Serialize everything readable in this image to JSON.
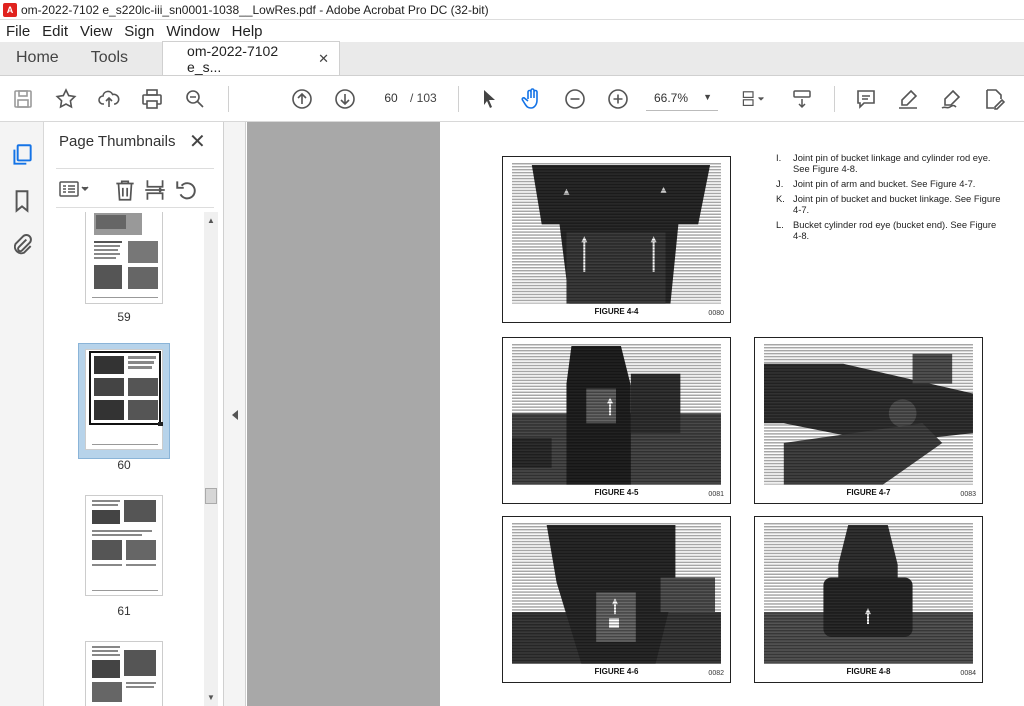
{
  "window": {
    "title": "om-2022-7102 e_s220lc-iii_sn0001-1038__LowRes.pdf - Adobe Acrobat Pro DC (32-bit)"
  },
  "menu": [
    "File",
    "Edit",
    "View",
    "Sign",
    "Window",
    "Help"
  ],
  "tabs": {
    "home": "Home",
    "tools": "Tools",
    "document": "om-2022-7102 e_s...",
    "close": "✕"
  },
  "toolbar": {
    "page_current": "60",
    "page_total": "/ 103",
    "zoom": "66.7%"
  },
  "panel": {
    "title": "Page Thumbnails",
    "close": "✕",
    "thumbnails": [
      {
        "label": "59",
        "selected": false
      },
      {
        "label": "60",
        "selected": true
      },
      {
        "label": "61",
        "selected": false
      },
      {
        "label": "",
        "selected": false
      }
    ]
  },
  "document": {
    "pin_list": [
      {
        "letter": "I.",
        "text": "Joint pin of bucket linkage and cylinder rod eye. See Figure 4-8."
      },
      {
        "letter": "J.",
        "text": "Joint pin of arm and bucket. See Figure 4-7."
      },
      {
        "letter": "K.",
        "text": "Joint pin of bucket and bucket linkage. See Figure 4-7."
      },
      {
        "letter": "L.",
        "text": "Bucket cylinder rod eye (bucket end). See Figure 4-8."
      }
    ],
    "figures": [
      {
        "caption": "FIGURE 4-4",
        "code": "0080"
      },
      {
        "caption": "FIGURE 4-5",
        "code": "0081"
      },
      {
        "caption": "FIGURE 4-7",
        "code": "0083"
      },
      {
        "caption": "FIGURE 4-6",
        "code": "0082"
      },
      {
        "caption": "FIGURE 4-8",
        "code": "0084"
      }
    ]
  }
}
